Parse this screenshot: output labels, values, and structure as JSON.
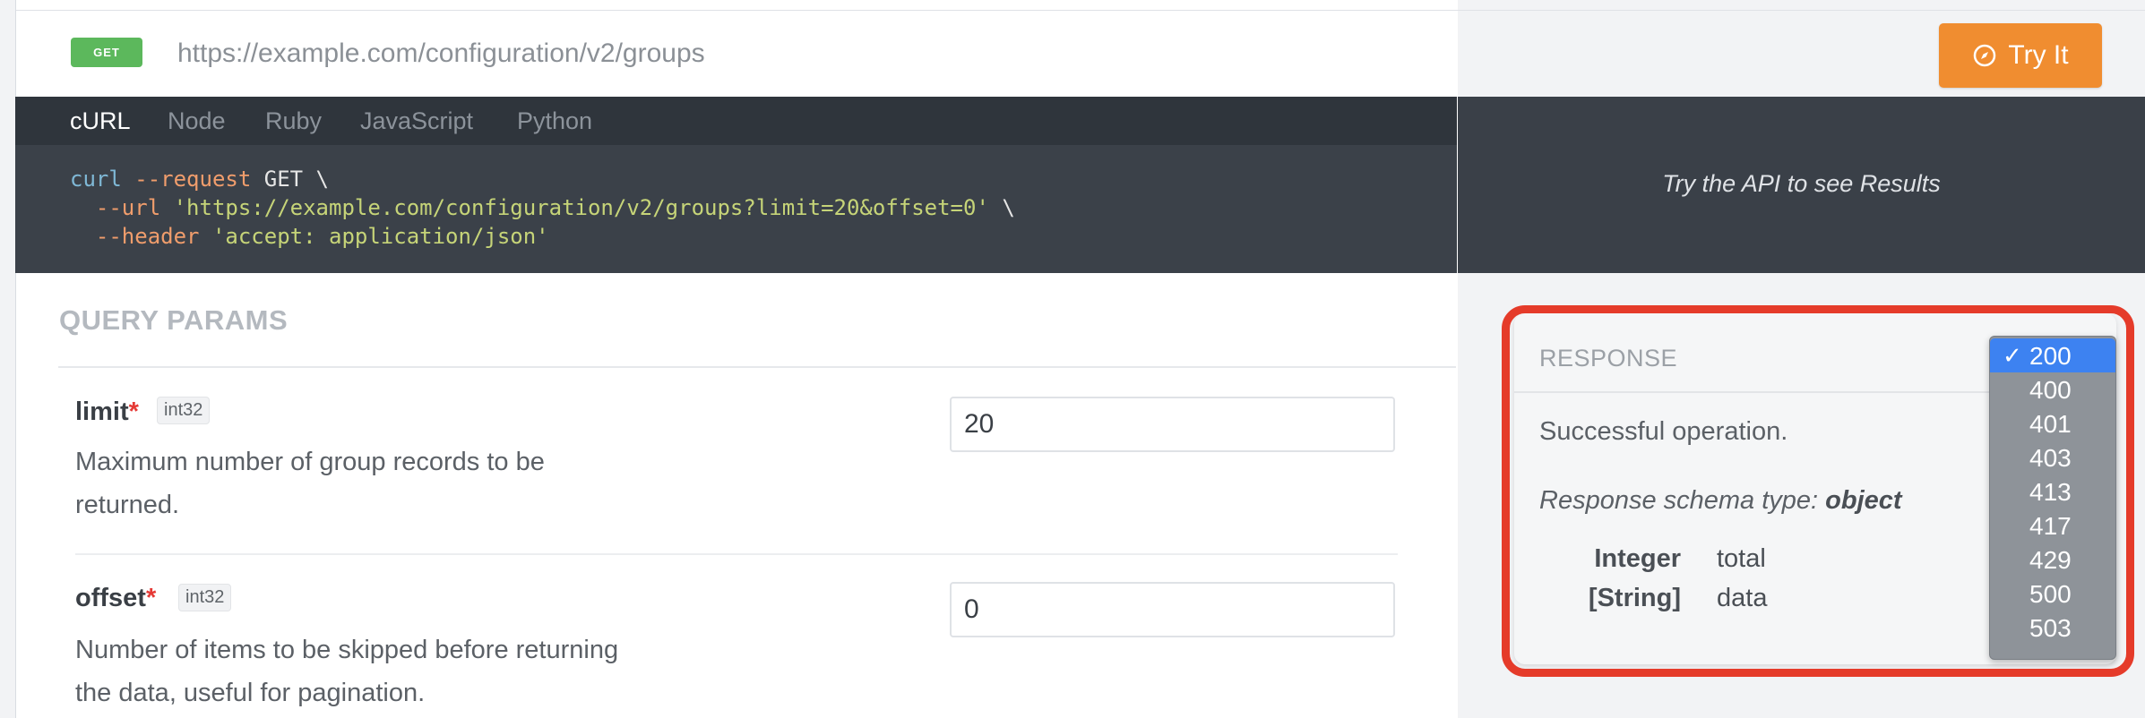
{
  "request": {
    "method": "GET",
    "url": "https://example.com/configuration/v2/groups",
    "try_button": "Try It"
  },
  "code_tabs": [
    "cURL",
    "Node",
    "Ruby",
    "JavaScript",
    "Python"
  ],
  "code_tab_active": "cURL",
  "code_lines": {
    "l1": {
      "a": "curl",
      "b": " --request",
      "c": " GET \\"
    },
    "l2": {
      "a": "  --url",
      "b": " 'https://example.com/configuration/v2/groups?limit=20&offset=0'",
      "c": " \\"
    },
    "l3": {
      "a": "  --header",
      "b": " 'accept: application/json'"
    }
  },
  "results": {
    "placeholder": "Try the API to see Results"
  },
  "query_params": {
    "title": "QUERY PARAMS",
    "params": [
      {
        "name": "limit",
        "required": "*",
        "type": "int32",
        "desc_line1": "Maximum number of group records to be",
        "desc_line2": "returned.",
        "value": "20"
      },
      {
        "name": "offset",
        "required": "*",
        "type": "int32",
        "desc_line1": "Number of items to be skipped before returning",
        "desc_line2": "the data, useful for pagination.",
        "value": "0"
      }
    ]
  },
  "response": {
    "label": "RESPONSE",
    "description": "Successful operation.",
    "schema_prefix": "Response schema type: ",
    "schema_type": "object",
    "fields": [
      {
        "type": "Integer",
        "name": "total"
      },
      {
        "type": "[String]",
        "name": "data"
      }
    ],
    "status_options": [
      "200",
      "400",
      "401",
      "403",
      "413",
      "417",
      "429",
      "500",
      "503"
    ],
    "selected_status": "200",
    "check_mark": "✓"
  },
  "colors": {
    "method_badge": "#5cb85c",
    "try_button": "#f08d30",
    "highlight": "#e53b2a",
    "dropdown_selected": "#3d82f1"
  }
}
